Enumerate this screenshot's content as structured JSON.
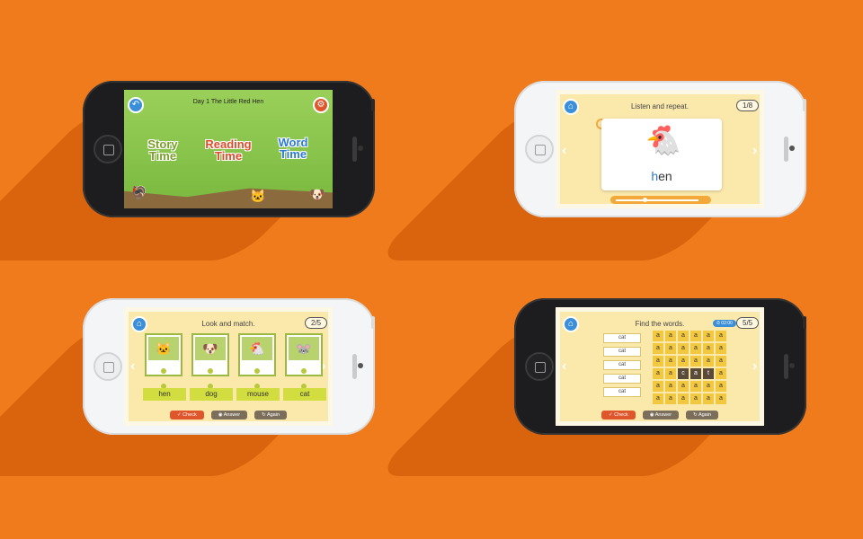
{
  "screen1": {
    "title": "Day 1 The Little Red Hen",
    "menu": {
      "story": "Story Time",
      "reading": "Reading Time",
      "word": "Word Time"
    }
  },
  "screen2": {
    "title": "Listen and repeat.",
    "page": "1/8",
    "word_first": "h",
    "word_rest": "en"
  },
  "screen3": {
    "title": "Look and match.",
    "page": "2/5",
    "words": [
      "hen",
      "dog",
      "mouse",
      "cat"
    ],
    "buttons": {
      "check": "Check",
      "answer": "Answer",
      "again": "Again"
    }
  },
  "screen4": {
    "title": "Find the words.",
    "page": "5/5",
    "timer": "02:00",
    "words": [
      "cat",
      "cat",
      "cat",
      "cat",
      "cat"
    ],
    "grid": [
      [
        "a",
        "a",
        "a",
        "a",
        "a",
        "a"
      ],
      [
        "a",
        "a",
        "a",
        "a",
        "a",
        "a"
      ],
      [
        "a",
        "a",
        "a",
        "a",
        "a",
        "a"
      ],
      [
        "a",
        "a",
        "c",
        "a",
        "t",
        "a"
      ],
      [
        "a",
        "a",
        "a",
        "a",
        "a",
        "a"
      ],
      [
        "a",
        "a",
        "a",
        "a",
        "a",
        "a"
      ]
    ],
    "buttons": {
      "check": "Check",
      "answer": "Answer",
      "again": "Again"
    }
  }
}
